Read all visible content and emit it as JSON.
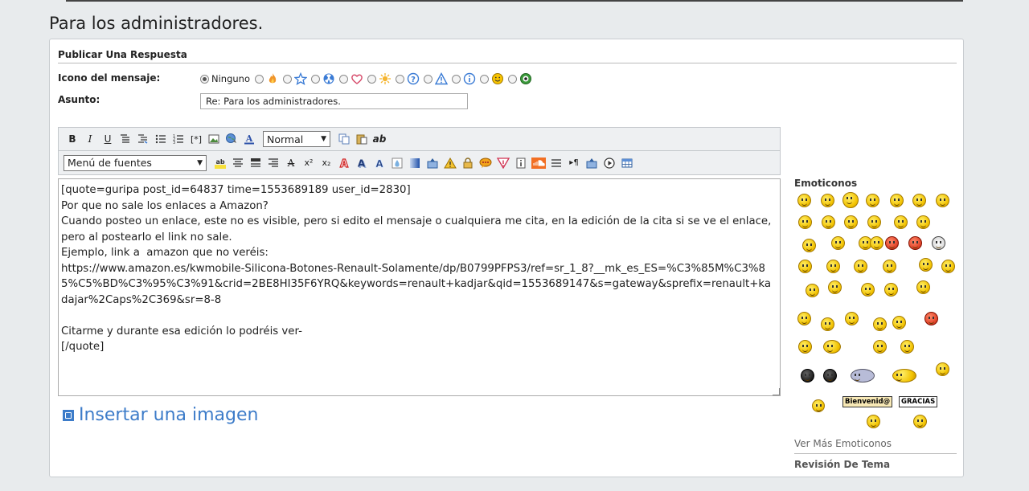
{
  "page": {
    "title": "Para los administradores."
  },
  "form": {
    "heading": "Publicar Una Respuesta",
    "icon_label": "Icono del mensaje:",
    "icon_none_label": "Ninguno",
    "icons": [
      "fire-icon",
      "star-icon",
      "radioactive-icon",
      "heart-icon",
      "star-burst-icon",
      "question-icon",
      "warning-icon",
      "info-icon",
      "smiley-icon",
      "green-face-icon"
    ],
    "subject_label": "Asunto:",
    "subject_value": "Re: Para los administradores.",
    "size_select": "Normal",
    "font_select": "Menú de fuentes",
    "editor_text": "[quote=guripa post_id=64837 time=1553689189 user_id=2830]\nPor que no sale los enlaces a Amazon?\nCuando posteo un enlace, este no es visible, pero si edito el mensaje o cualquiera me cita, en la edición de la cita si se ve el enlace, pero al postearlo el link no sale.\nEjemplo, link a  amazon que no veréis:\nhttps://www.amazon.es/kwmobile-Silicona-Botones-Renault-Solamente/dp/B0799PFPS3/ref=sr_1_8?__mk_es_ES=%C3%85M%C3%85%C5%BD%C3%95%C3%91&crid=2BE8HI35F6YRQ&keywords=renault+kadjar&qid=1553689147&s=gateway&sprefix=renault+kadajar%2Caps%2C369&sr=8-8\n\nCitarme y durante esa edición lo podréis ver-\n[/quote]",
    "insert_image": "Insertar una imagen"
  },
  "toolbar1": [
    "B",
    "I",
    "U"
  ],
  "emoticons": {
    "title": "Emoticonos",
    "sign_welcome": "Bienvenid@",
    "sign_thanks": "GRACIAS",
    "more": "Ver Más Emoticonos",
    "review": "Revisión De Tema"
  },
  "colors": {
    "accent": "#3d7cc9",
    "background": "#e8ebed"
  }
}
